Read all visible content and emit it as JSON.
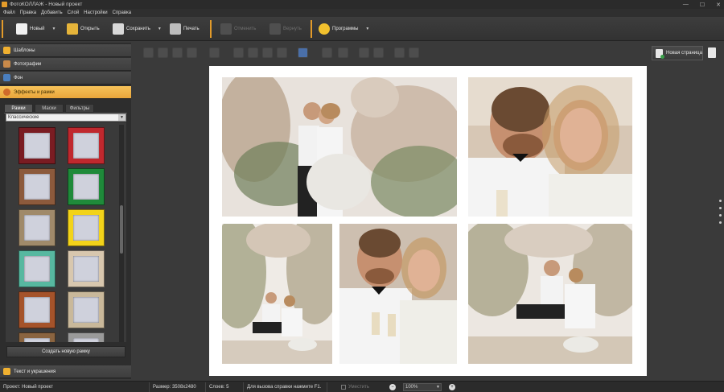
{
  "window": {
    "title": "ФотоКОЛЛАЖ - Новый проект",
    "controls": [
      "—",
      "☐",
      "✕"
    ]
  },
  "menu": [
    "Файл",
    "Правка",
    "Добавить",
    "Слой",
    "Настройки",
    "Справка"
  ],
  "toolbar": {
    "new_label": "Новый",
    "open_label": "Открыть",
    "save_label": "Сохранить",
    "print_label": "Печать",
    "undo_label": "Отменить",
    "redo_label": "Вернуть",
    "programs_label": "Программы",
    "colors": {
      "accent": "#e39b2a"
    }
  },
  "left_panel": {
    "sections": {
      "templates": "Шаблоны",
      "photos": "Фотографии",
      "background": "Фон",
      "effects": "Эффекты и рамки",
      "text": "Текст и украшения"
    },
    "tabs": [
      "Рамки",
      "Маски",
      "Фильтры"
    ],
    "active_tab": "Рамки",
    "category": "Классические",
    "frames": [
      {
        "style": "dark-red-ornate",
        "color": "#7a1c22"
      },
      {
        "style": "red-ornate",
        "color": "#c0282e"
      },
      {
        "style": "brown-beveled",
        "color": "#8c5a3c"
      },
      {
        "style": "green-ornate",
        "color": "#1f8a3a"
      },
      {
        "style": "tan-classic",
        "color": "#a08a6a"
      },
      {
        "style": "yellow-gold",
        "color": "#f2d31a"
      },
      {
        "style": "teal-dotted",
        "color": "#57b8a0"
      },
      {
        "style": "beige-simple",
        "color": "#d8c7ae"
      },
      {
        "style": "rust-ornate",
        "color": "#a5532a"
      },
      {
        "style": "cream-beveled",
        "color": "#c9b89a"
      },
      {
        "style": "bronze-partial",
        "color": "#8a6440"
      },
      {
        "style": "gray-partial",
        "color": "#9a9a9a"
      }
    ],
    "create_frame_label": "Создать новую рамку"
  },
  "canvas": {
    "new_page_label": "Новая страница"
  },
  "status": {
    "project_label": "Проект: Новый проект",
    "size_label": "Размер: 3508x2480",
    "layers_label": "Слоев: 5",
    "help_label": "Для вызова справки нажмите F1.",
    "fit_label": "Уместить",
    "zoom": "100%"
  }
}
